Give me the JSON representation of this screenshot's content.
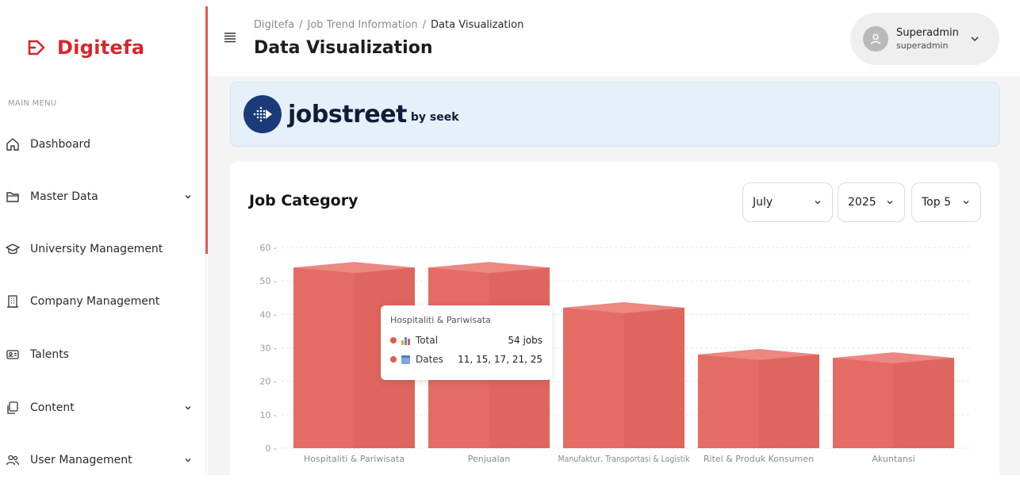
{
  "app": {
    "brand_name": "Digitefa"
  },
  "sidebar": {
    "section_label": "MAIN MENU",
    "items": [
      {
        "label": "Dashboard",
        "icon": "home-icon",
        "has_submenu": false
      },
      {
        "label": "Master Data",
        "icon": "folder-icon",
        "has_submenu": true
      },
      {
        "label": "University Management",
        "icon": "graduation-cap-icon",
        "has_submenu": false
      },
      {
        "label": "Company Management",
        "icon": "building-icon",
        "has_submenu": false
      },
      {
        "label": "Talents",
        "icon": "id-card-icon",
        "has_submenu": false
      },
      {
        "label": "Content",
        "icon": "copy-icon",
        "has_submenu": true
      },
      {
        "label": "User Management",
        "icon": "users-icon",
        "has_submenu": true
      }
    ]
  },
  "header": {
    "breadcrumb": [
      "Digitefa",
      "Job Trend Information",
      "Data Visualization"
    ],
    "breadcrumb_separator": "/",
    "title": "Data Visualization",
    "user": {
      "name": "Superadmin",
      "role": "superadmin"
    }
  },
  "banner": {
    "brand": "jobstreet",
    "suffix": "by seek"
  },
  "card": {
    "title": "Job Category",
    "filters": {
      "month": "July",
      "year": "2025",
      "top": "Top 5"
    }
  },
  "tooltip": {
    "category": "Hospitaliti & Pariwisata",
    "rows": [
      {
        "name": "Total",
        "value": "54 jobs"
      },
      {
        "name": "Dates",
        "value": "11, 15, 17, 21, 25"
      }
    ]
  },
  "colors": {
    "accent": "#d9252d",
    "bar": "#e36c65",
    "bar_top": "#ec8782",
    "bar_dark": "#d85c55"
  },
  "chart_data": {
    "type": "bar",
    "categories": [
      "Hospitaliti & Pariwisata",
      "Penjualan",
      "Manufaktur, Transportasi & Logistik",
      "Ritel & Produk Konsumen",
      "Akuntansi"
    ],
    "values": [
      54,
      54,
      42,
      28,
      27
    ],
    "ylim": [
      0,
      60
    ],
    "yticks": [
      0,
      10,
      20,
      30,
      40,
      50,
      60
    ],
    "grid": true,
    "title": "",
    "xlabel": "",
    "ylabel": ""
  }
}
